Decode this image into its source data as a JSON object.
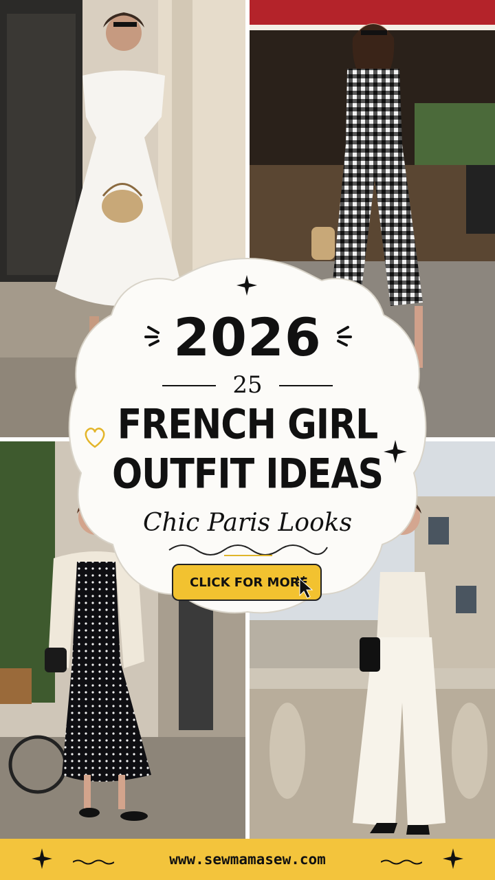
{
  "hero": {
    "year": "2026",
    "count": "25",
    "headline_line1": "FRENCH GIRL",
    "headline_line2": "OUTFIT IDEAS",
    "subtitle": "Chic Paris Looks",
    "cta_label": "CLICK FOR MORE"
  },
  "footer": {
    "url": "www.sewmamasew.com"
  },
  "photos": [
    {
      "subject": "white puff-sleeve midi dress with woven round bag"
    },
    {
      "subject": "black and white gingham jumpsuit by a Paris cafe"
    },
    {
      "subject": "polka dot midi dress with cream cardigan and bicycle"
    },
    {
      "subject": "white corset top and wide-leg trousers on a balcony"
    }
  ],
  "icons": {
    "cta": "cursor-icon",
    "decor": [
      "sparkle-icon",
      "heart-icon",
      "star-icon"
    ]
  },
  "colors": {
    "accent": "#f2c230",
    "footer": "#f3c43c",
    "text": "#111111",
    "badge": "#fcfbf8"
  }
}
